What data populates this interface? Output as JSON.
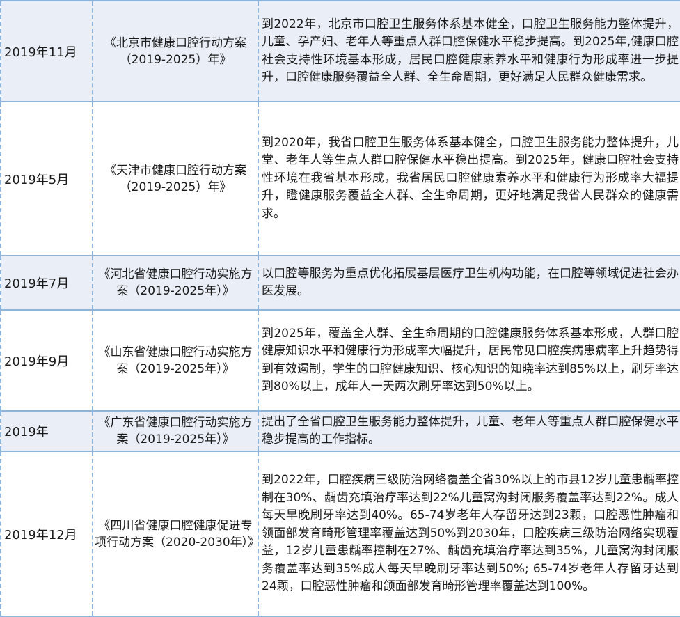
{
  "rows": [
    {
      "date": "2019年11月",
      "name": "《北京市健康口腔行动方案（2019-2025）年》",
      "goal": "到2022年，北京市口腔卫生服务体系基本健全，口腔卫生服务能力整体提升，儿童、孕产妇、老年人等重点人群口腔保健水平稳步提高。到2025年,健康口腔社会支持性环境基本形成，居民口腔健康素养水平和健康行为形成率进一步提升，口腔健康服务覆益全人群、全生命周期，更好满足人民群众健康需求。"
    },
    {
      "date": "2019年5月",
      "name": "《天津市健康口腔行动方案（2019-2025）年》",
      "goal": "到2020年，我省口腔卫生服务体系基本健全，口腔卫生服务能力整体提升，儿堂、老年人等生点人群口腔保健水平稳出提高。到2025年，健康口腔社会支持性环境在我省基本形成，我省居民口腔健康素养水平和健康行为形成率大福提升，瞪健康服务覆益全人群、全生命周期，更好地满足我省人民群众的健康需求。"
    },
    {
      "date": "2019年7月",
      "name": "《河北省健康口腔行动实施方案（2019-2025年）》",
      "goal": "以口腔等服务为重点优化拓展基层医疗卫生机构功能，在口腔等领域促进社会办医发展。"
    },
    {
      "date": "2019年9月",
      "name": "《山东省健康口腔行动实施方案（2019-2025年）》",
      "goal": "到2025年，覆盖全人群、全生命周期的口腔健康服务体系基本形成，人群口腔健康知识水平和健康行为形成率大幅提升，居民常见口腔疾病患病率上升趋势得到有效遏制，学生的口腔健康知识、核心知识的知晓率达到85%以上，刷牙率达到80%以上，成年人一天两次刷牙率达到50%以上。"
    },
    {
      "date": "2019年",
      "name": "《广东省健康口腔行动实施方案（2019-2025年）》",
      "goal": "提出了全省口腔卫生服务能力整体提升，儿童、老年人等重点人群口腔保健水平稳步提高的工作指标。"
    },
    {
      "date": "2019年12月",
      "name": "《四川省健康口腔健康促进专项行动方案（2020-2030年）》",
      "goal": "到2022年，口腔疾病三级防治网络覆盖全省30%以上的市县12岁儿童患龋率控制在30%、龋齿充填治疗率达到22%儿童窝沟封闭服务覆盖率达到22%。成人每天早晚刷牙率达到40%。65-74岁老年人存留牙达到23颗，口腔恶性肿瘤和领面部发育畸形管理率覆盖达到50%到2030年，口腔疾病三级防治网络实现覆益，12岁儿童患龋率控制在27%、龋齿充填治疗率达到35%，儿童窝沟封闭服务覆盖率达到35%成人每天早晚刷牙率达到50%; 65-74岁老年人存留牙达到24颗，口腔恶性肿瘤和颌面部发育畸形管理率覆盖达到100%。"
    }
  ]
}
